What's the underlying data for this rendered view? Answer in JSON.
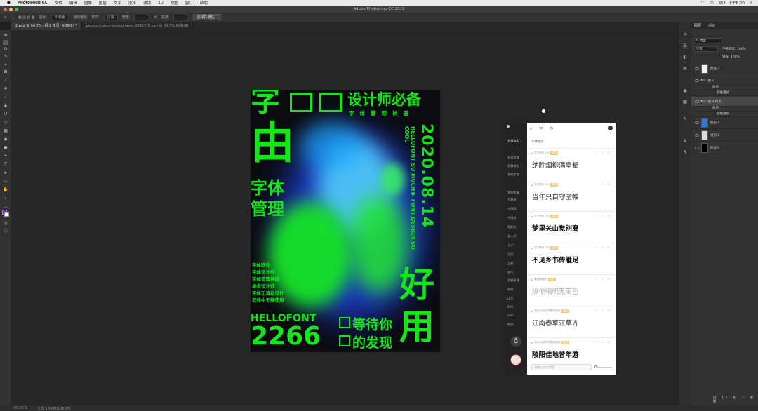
{
  "menubar": {
    "app": "Photoshop CC",
    "items": [
      "文件",
      "编辑",
      "图像",
      "图层",
      "文字",
      "选择",
      "滤镜",
      "3D",
      "视图",
      "窗口",
      "帮助"
    ],
    "clock": "周五 下午6:20"
  },
  "window": {
    "title": "Adobe Photoshop CC 2019"
  },
  "options": {
    "feather_label": "羽化:",
    "feather_value": "0 像素",
    "antialias": "消除锯齿",
    "style_label": "样式:",
    "style_value": "正常",
    "width_label": "宽度:",
    "height_label": "高度:",
    "select_mask": "选择并遮住..."
  },
  "tabs": [
    {
      "label": "2.psd @ 66.7% (组 2 拷贝, RGB/8) *",
      "active": true
    },
    {
      "label": "pexels-charon-mccutcheon-3695378.psd @ 66.7%(RGB/8)",
      "active": false
    }
  ],
  "poster": {
    "title_line": "设计师必备",
    "subtitle": "字体管理神器",
    "big1": "字",
    "big2": "由",
    "mid_text": "字体",
    "mid_text2": "管理",
    "date": "2020.08.14",
    "vertical_en": "HELLOFONT SO MUCH♥ FONT DESIGN SO COOL",
    "right_big1": "好",
    "right_big2": "用",
    "hellofont": "HELLOFONT",
    "num": "2266",
    "bottom1": "等待你",
    "bottom2": "的发现",
    "small_lines": [
      "字体软件",
      "字体设计师",
      "字体管理神器",
      "单身设计师",
      "字体工具在设计",
      "软件中无缝使用"
    ]
  },
  "status": {
    "zoom": "66.67%",
    "doc": "文档:14.6M/108.8M"
  },
  "layers_panel": {
    "tabs": [
      "图层",
      "通道"
    ],
    "kind": "Q 类型",
    "blend": "正常",
    "opacity": "不透明度: 100%",
    "fill": "填充: 100%",
    "rows": [
      {
        "name": "图层 2",
        "thumb": "#f2f2f2"
      },
      {
        "name": "组 2",
        "thumb": ""
      },
      {
        "name": "效果",
        "thumb": ""
      },
      {
        "name": "颜色叠加",
        "thumb": ""
      },
      {
        "name": "组 2 拷贝",
        "thumb": ""
      },
      {
        "name": "效果",
        "thumb": ""
      },
      {
        "name": "颜色叠加",
        "thumb": ""
      },
      {
        "name": "图层 1",
        "thumb": "#2a7ad8"
      },
      {
        "name": "组别 1",
        "thumb": "#dcdcdc"
      },
      {
        "name": "图层 0",
        "thumb": "#000000"
      }
    ]
  },
  "font_manager": {
    "sidebar": [
      "会员商用",
      "发现字体",
      "免费商用",
      "我的字体",
      "我的收藏",
      "写意体",
      "中国风",
      "中国节",
      "简影化",
      "画人节",
      "七夕",
      "古风",
      "卫星",
      "秀气",
      "涂鸦新潮",
      "海报",
      "正文",
      "520",
      "sum...",
      "新建"
    ],
    "filter": "字体推荐",
    "fonts": [
      {
        "meta": "汉字黑体 55J",
        "sample": "绝胜烟柳满皇都"
      },
      {
        "meta": "汉字黑体 55J",
        "sample": "当年只自守空帷"
      },
      {
        "meta": "汉字黑体 55J",
        "sample": "梦里关山觉别离"
      },
      {
        "meta": "汉字黑体 55J",
        "sample": "不见乡书传雁足"
      },
      {
        "meta": "素画格格体",
        "sample": "纵使晴明无雨色"
      },
      {
        "meta": "汉仪天真体-阿里妈妈版",
        "sample": "江南春草江草齐"
      },
      {
        "meta": "汉仪天真体-阿里妈妈版",
        "sample": "陵阳佳地昔年游"
      }
    ],
    "input_placeholder": "请输入文字内容",
    "tag": "会员"
  }
}
